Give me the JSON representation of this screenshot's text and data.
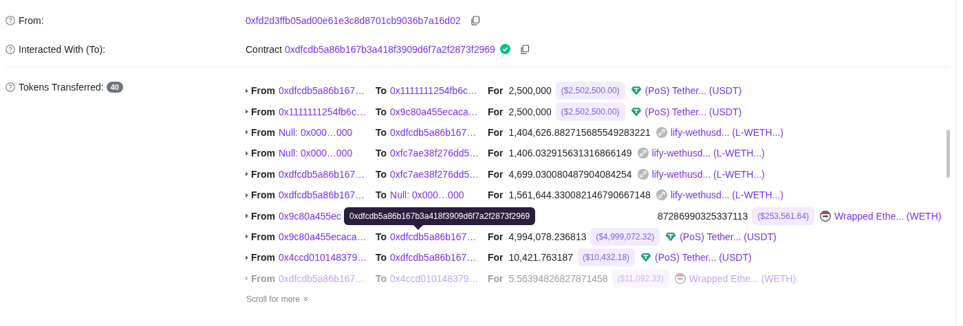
{
  "from": {
    "label": "From:",
    "address": "0xfd2d3ffb05ad00e61e3c8d8701cb9036b7a16d02"
  },
  "interacted_with": {
    "label": "Interacted With (To):",
    "prefix": "Contract",
    "address": "0xdfcdb5a86b167b3a418f3909d6f7a2f2873f2969",
    "verified": true
  },
  "tokens_transferred": {
    "label": "Tokens Transferred:",
    "count": "40",
    "rows": [
      {
        "from_label": "From",
        "from": "0xdfcdb5a86b167…",
        "to_label": "To",
        "to": "0x1111111254fb6c…",
        "for_label": "For",
        "amount": "2,500,000",
        "value": "($2,502,500.00)",
        "kind": "tether",
        "token": "(PoS) Tether... (USDT)",
        "faded": false
      },
      {
        "from_label": "From",
        "from": "0x1111111254fb6c…",
        "to_label": "To",
        "to": "0x9c80a455ecaca…",
        "for_label": "For",
        "amount": "2,500,000",
        "value": "($2,502,500.00)",
        "kind": "tether",
        "token": "(PoS) Tether... (USDT)",
        "faded": false
      },
      {
        "from_label": "From",
        "from": "Null: 0x000…000",
        "to_label": "To",
        "to": "0xdfcdb5a86b167…",
        "for_label": "For",
        "amount": "1,404,626.882715685549283221",
        "kind": "link",
        "token": "lify-wethusd... (L-WETH...)",
        "faded": false
      },
      {
        "from_label": "From",
        "from": "Null: 0x000…000",
        "to_label": "To",
        "to": "0xfc7ae38f276dd5…",
        "for_label": "For",
        "amount": "1,406.032915631316866149",
        "kind": "link",
        "token": "lify-wethusd... (L-WETH...)",
        "faded": false
      },
      {
        "from_label": "From",
        "from": "0xdfcdb5a86b167…",
        "to_label": "To",
        "to": "0xfc7ae38f276dd5…",
        "for_label": "For",
        "amount": "4,699.030080487904084254",
        "kind": "link",
        "token": "lify-wethusd... (L-WETH...)",
        "faded": false
      },
      {
        "from_label": "From",
        "from": "0xdfcdb5a86b167…",
        "to_label": "To",
        "to": "Null: 0x000…000",
        "for_label": "For",
        "amount": "1,561,644.330082146790667148",
        "kind": "link",
        "token": "lify-wethusd... (L-WETH...)",
        "faded": false
      },
      {
        "from_label": "From",
        "from": "0x9c80a455ec",
        "amount": "87286990325337113",
        "value": "($253,561.64)",
        "kind": "weth",
        "token": "Wrapped Ethe... (WETH)",
        "faded": false
      },
      {
        "from_label": "From",
        "from": "0x9c80a455ecaca…",
        "to_label": "To",
        "to": "0xdfcdb5a86b167…",
        "for_label": "For",
        "amount": "4,994,078.236813",
        "value": "($4,999,072.32)",
        "kind": "tether",
        "token": "(PoS) Tether... (USDT)",
        "faded": false
      },
      {
        "from_label": "From",
        "from": "0x4ccd010148379…",
        "to_label": "To",
        "to": "0xdfcdb5a86b167…",
        "for_label": "For",
        "amount": "10,421.763187",
        "value": "($10,432.18)",
        "kind": "tether",
        "token": "(PoS) Tether... (USDT)",
        "faded": false
      },
      {
        "from_label": "From",
        "from": "0xdfcdb5a86b167…",
        "to_label": "To",
        "to": "0x4ccd010148379…",
        "for_label": "For",
        "amount": "5.56394826827871458",
        "value": "($11,092.33)",
        "kind": "weth",
        "token": "Wrapped Ethe... (WETH)",
        "faded": true
      }
    ],
    "tooltip": "0xdfcdb5a86b167b3a418f3909d6f7a2f2873f2969",
    "scroll_hint": "Scroll for more"
  }
}
